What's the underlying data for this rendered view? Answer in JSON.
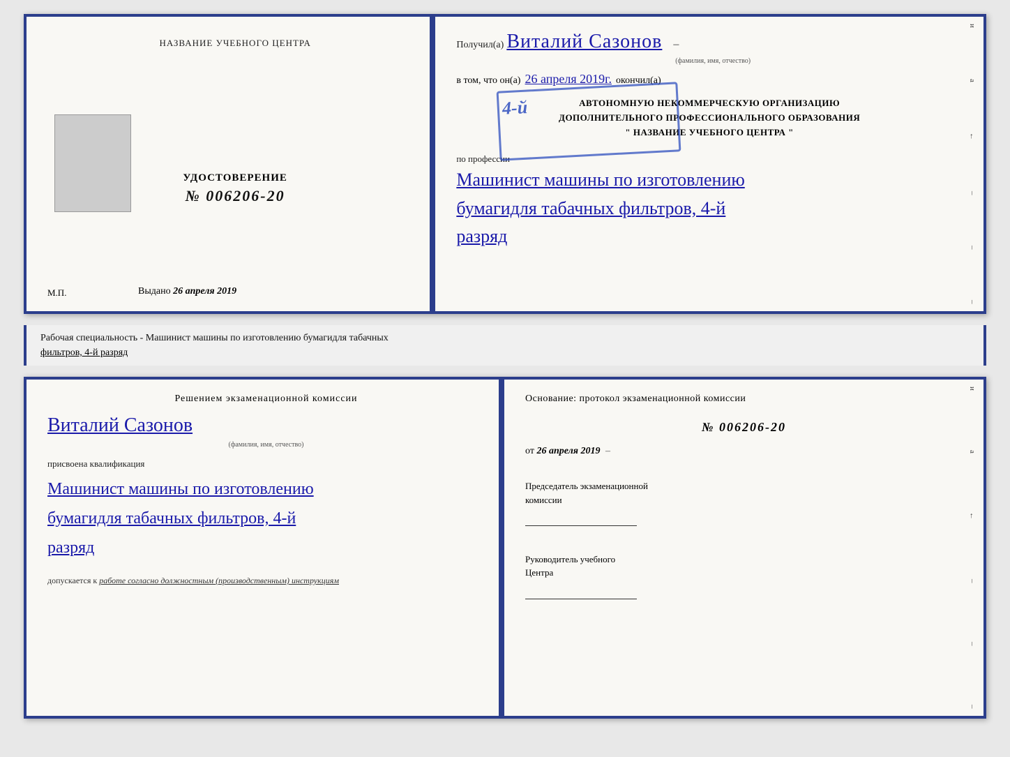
{
  "top_left": {
    "title": "НАЗВАНИЕ УЧЕБНОГО ЦЕНТРА",
    "cert_label": "УДОСТОВЕРЕНИЕ",
    "cert_number": "№ 006206-20",
    "issued_prefix": "Выдано",
    "issued_date": "26 апреля 2019",
    "mp_label": "М.П."
  },
  "top_right": {
    "received_prefix": "Получил(а)",
    "name": "Виталий Сазонов",
    "name_subtitle": "(фамилия, имя, отчество)",
    "vtom_prefix": "в том, что он(а)",
    "vtom_date": "26 апреля 2019г.",
    "vtom_suffix": "окончил(а)",
    "stamp_line1": "АВТОНОМНУЮ НЕКОММЕРЧЕСКУЮ ОРГАНИЗАЦИЮ",
    "stamp_line2": "ДОПОЛНИТЕЛЬНОГО ПРОФЕССИОНАЛЬНОГО ОБРАЗОВАНИЯ",
    "stamp_line3": "\" НАЗВАНИЕ УЧЕБНОГО ЦЕНТРА \"",
    "stamp_big": "4-й",
    "profession_prefix": "по профессии",
    "profession_line1": "Машинист машины по изготовлению",
    "profession_line2": "бумагидля табачных фильтров, 4-й",
    "profession_line3": "разряд",
    "edge_letters": [
      "и",
      "а",
      "←",
      "–",
      "–",
      "–",
      "–"
    ]
  },
  "description": {
    "text_prefix": "Рабочая специальность - Машинист машины по изготовлению бумагидля табачных",
    "text_underline": "фильтров, 4-й разряд"
  },
  "bottom_left": {
    "title": "Решением экзаменационной комиссии",
    "name": "Виталий Сазонов",
    "name_subtitle": "(фамилия, имя, отчество)",
    "assigned_label": "присвоена квалификация",
    "profession_line1": "Машинист машины по изготовлению",
    "profession_line2": "бумагидля табачных фильтров, 4-й",
    "profession_line3": "разряд",
    "допускается_prefix": "допускается к",
    "допускается_text": "работе согласно должностным (производственным) инструкциям"
  },
  "bottom_right": {
    "osnov_label": "Основание: протокол экзаменационной комиссии",
    "number": "№ 006206-20",
    "date_prefix": "от",
    "date_value": "26 апреля 2019",
    "chairman_label": "Председатель экзаменационной",
    "chairman_label2": "комиссии",
    "director_label": "Руководитель учебного",
    "director_label2": "Центра",
    "edge_letters": [
      "и",
      "а",
      "←",
      "–",
      "–",
      "–",
      "–"
    ]
  }
}
